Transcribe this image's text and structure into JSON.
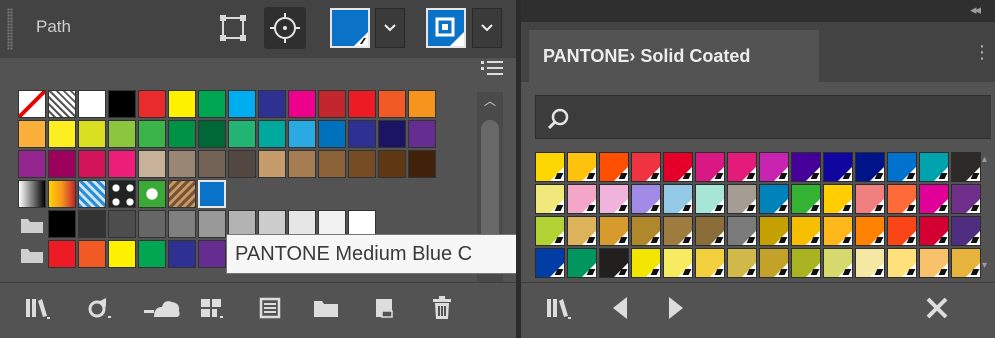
{
  "left_panel": {
    "header_label": "Path",
    "icons": {
      "anchor_tool": "anchor-point-icon",
      "circle_tool": "circle-target-icon",
      "dropdown": "chevron-down-icon",
      "panel_menu": "list-menu-icon"
    },
    "fill_color": "#0a73c7",
    "stroke_color": "#0a73c7",
    "swatch_rows": [
      [
        "none",
        "registration",
        "#ffffff",
        "#000000",
        "#e92b2b",
        "#fff200",
        "#00a651",
        "#00aeef",
        "#2e3192",
        "#ec008c",
        "#c1272d",
        "#ed1c24",
        "#f15a24",
        "#f7941e"
      ],
      [
        "#fbb03b",
        "#fcee21",
        "#d9e021",
        "#8cc63f",
        "#39b54a",
        "#009245",
        "#006837",
        "#22b573",
        "#00a99d",
        "#29abe2",
        "#0071bc",
        "#2e3192",
        "#1b1464",
        "#662d91"
      ],
      [
        "#93278f",
        "#9e005d",
        "#d4145a",
        "#ed1e79",
        "#c7b299",
        "#998675",
        "#736357",
        "#534741",
        "#c69c6d",
        "#a67c52",
        "#8c6239",
        "#754c24",
        "#603813",
        "#42210b"
      ],
      [
        "gradient-gray",
        "gradient-orange",
        "pattern-blue",
        "pattern-dots",
        "pattern-green",
        "pattern-brown",
        "spot-blue"
      ]
    ],
    "gray_group": [
      "#000000",
      "#333333",
      "#4d4d4d",
      "#666666",
      "#808080",
      "#999999",
      "#b3b3b3",
      "#cccccc",
      "#e6e6e6",
      "#f2f2f2",
      "#ffffff"
    ],
    "bright_group": [
      "#ed1c24",
      "#f15a24",
      "#fff200",
      "#00a651",
      "#2e3192",
      "#662d91"
    ],
    "tooltip": "PANTONE Medium Blue C",
    "toolbar_icons": [
      "swatch-libraries-icon",
      "show-kinds-icon",
      "cloud-library-icon",
      "swatch-options-icon",
      "color-group-icon",
      "new-folder-icon",
      "new-swatch-icon",
      "trash-icon"
    ]
  },
  "right_panel": {
    "tab_title": "PANTONE› Solid Coated",
    "search_icon": "search-icon",
    "menu_icon": "panel-menu-icon",
    "collapse_icon": "double-chevron-icon",
    "swatch_rows": [
      [
        "#ffd700",
        "#ffc20e",
        "#fe5000",
        "#ef3340",
        "#e4002b",
        "#da1884",
        "#e31c79",
        "#c724b1",
        "#440099",
        "#10069f",
        "#001489",
        "#0072ce",
        "#00a3ad",
        "#2d2926"
      ],
      [
        "#f0e87a",
        "#f4a6c8",
        "#f1b2dc",
        "#a18ae6",
        "#93c9e6",
        "#a7e6d7",
        "#a59c94",
        "#0082ba",
        "#34b233",
        "#ffcd00",
        "#f08080",
        "#ff6a39",
        "#e10098",
        "#702f8a"
      ],
      [
        "#b3d335",
        "#dcb35a",
        "#d69a2d",
        "#b0882b",
        "#9e7c40",
        "#8b6d3a",
        "#7a7a7a",
        "#c4a000",
        "#f6be00",
        "#ffb81c",
        "#ff8200",
        "#fa4616",
        "#d50032",
        "#4f2d7f"
      ],
      [
        "#003da5",
        "#00965e",
        "#221f1f",
        "#f2e500",
        "#f6eb61",
        "#f3d03e",
        "#d0b84a",
        "#c4a229",
        "#a9b31f",
        "#d6d96b",
        "#f5e8a5",
        "#ffe07a",
        "#f7c26b",
        "#e6b43c"
      ]
    ],
    "toolbar_icons": [
      "swatch-libraries-icon",
      "previous-arrow-icon",
      "next-arrow-icon",
      "close-x-icon"
    ]
  }
}
